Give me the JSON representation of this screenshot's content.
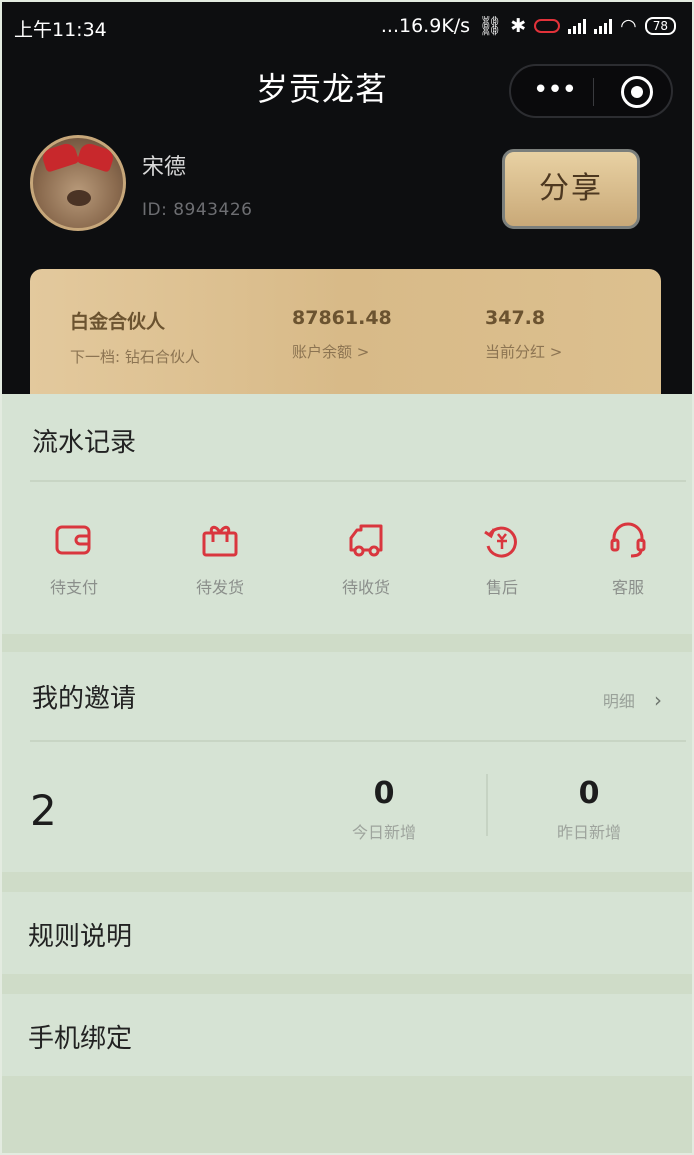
{
  "status_bar": {
    "time": "上午11:34",
    "network": "...16.9K/s",
    "battery": "78"
  },
  "nav": {
    "title": "岁贡龙茗",
    "more_label": "•••"
  },
  "user": {
    "name": "宋德",
    "id": "ID: 8943426"
  },
  "share_button": "分享",
  "gold_card": {
    "level": "白金合伙人",
    "next_level": "下一档: 钻石合伙人",
    "balance_value": "87861.48",
    "balance_label": "账户余额 >",
    "dividend_value": "347.8",
    "dividend_label": "当前分红 >"
  },
  "records": {
    "title": "流水记录",
    "items": [
      {
        "label": "待支付",
        "icon": "wallet-icon"
      },
      {
        "label": "待发货",
        "icon": "gift-box-icon"
      },
      {
        "label": "待收货",
        "icon": "truck-icon"
      },
      {
        "label": "售后",
        "icon": "refund-icon"
      },
      {
        "label": "客服",
        "icon": "headset-icon"
      }
    ]
  },
  "invite": {
    "title": "我的邀请",
    "detail_label": "明细",
    "total": "2",
    "today_value": "0",
    "today_label": "今日新增",
    "yesterday_value": "0",
    "yesterday_label": "昨日新增"
  },
  "rules": {
    "title": "规则说明"
  },
  "phone_bind": {
    "title": "手机绑定"
  },
  "colors": {
    "header_bg": "#0d0e10",
    "gold": "#d8ba88",
    "icon_red": "#d9363e",
    "section_bg": "#d6e3d4"
  }
}
